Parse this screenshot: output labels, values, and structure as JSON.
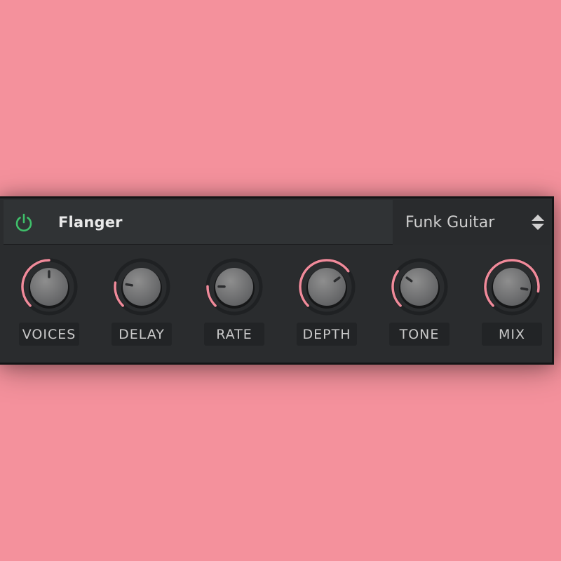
{
  "plugin": {
    "effect_name": "Flanger",
    "power_on": true,
    "preset": "Funk Guitar"
  },
  "colors": {
    "background": "#f4919c",
    "accent": "#f08a9a",
    "power": "#3fbf6a",
    "panel": "#2a2c2e"
  },
  "icons": {
    "power": "power-icon",
    "preset_stepper": "up-down-arrows-icon"
  },
  "knobs": [
    {
      "label": "VOICES",
      "value": 0.5
    },
    {
      "label": "DELAY",
      "value": 0.2
    },
    {
      "label": "RATE",
      "value": 0.17
    },
    {
      "label": "DEPTH",
      "value": 0.7
    },
    {
      "label": "TONE",
      "value": 0.3
    },
    {
      "label": "MIX",
      "value": 0.87
    }
  ]
}
